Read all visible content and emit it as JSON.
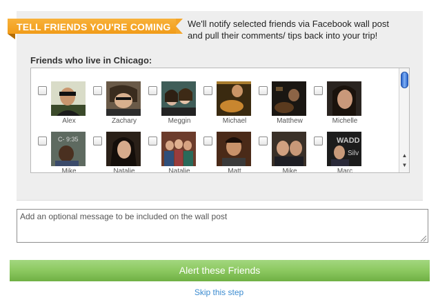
{
  "header": {
    "ribbon_label": "TELL FRIENDS YOU'RE COMING",
    "intro_line1": "We'll notify selected friends via Facebook wall post",
    "intro_line2": "and pull their comments/ tips back into your trip!"
  },
  "friends_section": {
    "title": "Friends who live in Chicago:",
    "friends": [
      {
        "name": "Alex",
        "checked": false
      },
      {
        "name": "Zachary",
        "checked": false
      },
      {
        "name": "Meggin",
        "checked": false
      },
      {
        "name": "Michael",
        "checked": false
      },
      {
        "name": "Matthew",
        "checked": false
      },
      {
        "name": "Michelle",
        "checked": false
      },
      {
        "name": "Mike",
        "checked": false
      },
      {
        "name": "Natalie",
        "checked": false
      },
      {
        "name": "Natalie",
        "checked": false
      },
      {
        "name": "Matt",
        "checked": false
      },
      {
        "name": "Mike",
        "checked": false
      },
      {
        "name": "Marc",
        "checked": false
      }
    ]
  },
  "message": {
    "placeholder": "Add an optional message to be included on the wall post",
    "value": ""
  },
  "actions": {
    "alert_label": "Alert these Friends",
    "skip_label": "Skip this step"
  },
  "colors": {
    "ribbon": "#f5a623",
    "button": "#8cc860",
    "link": "#3b8bd0"
  }
}
